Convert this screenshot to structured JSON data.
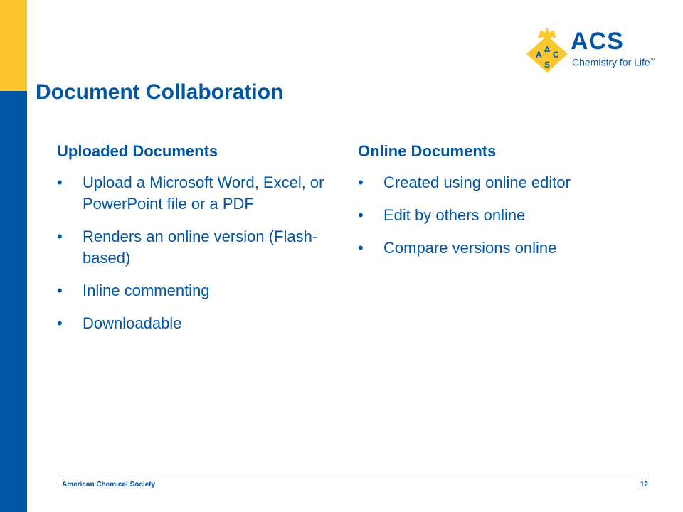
{
  "logo": {
    "name": "ACS",
    "tagline": "Chemistry for Life",
    "tagline_mark": "™",
    "emblem_letters": [
      "A",
      "C",
      "S"
    ]
  },
  "title": "Document Collaboration",
  "left_column": {
    "heading": "Uploaded Documents",
    "bullets": [
      "Upload a Microsoft Word, Excel, or PowerPoint file or a PDF",
      "Renders an online version (Flash-based)",
      "Inline commenting",
      "Downloadable"
    ]
  },
  "right_column": {
    "heading": "Online Documents",
    "bullets": [
      "Created using online editor",
      "Edit by others online",
      "Compare versions online"
    ]
  },
  "footer": {
    "organization": "American Chemical Society",
    "page_number": "12"
  },
  "bullet_symbol": "•",
  "colors": {
    "brand_blue": "#0055A4",
    "brand_yellow": "#FDC82F"
  }
}
